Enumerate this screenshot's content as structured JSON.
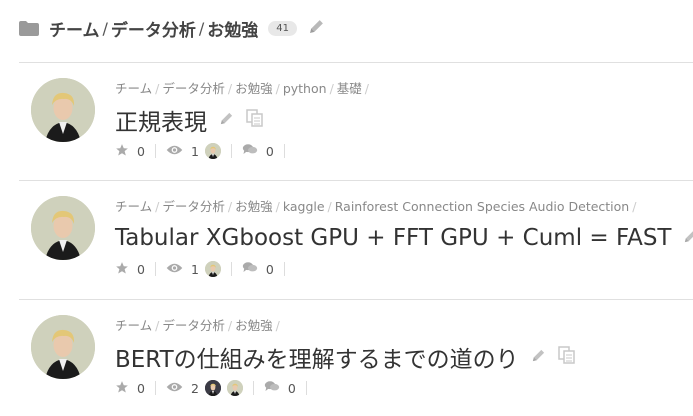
{
  "header": {
    "crumbs": [
      "チーム",
      "データ分析",
      "お勉強"
    ],
    "count": "41"
  },
  "posts": [
    {
      "categories": [
        "チーム",
        "データ分析",
        "お勉強",
        "python",
        "基礎"
      ],
      "title": "正規表現",
      "stars": "0",
      "views": "1",
      "comments": "0"
    },
    {
      "categories": [
        "チーム",
        "データ分析",
        "お勉強",
        "kaggle",
        "Rainforest Connection Species Audio Detection"
      ],
      "title": "Tabular XGboost GPU + FFT GPU + Cuml = FAST",
      "stars": "0",
      "views": "1",
      "comments": "0"
    },
    {
      "categories": [
        "チーム",
        "データ分析",
        "お勉強"
      ],
      "title": "BERTの仕組みを理解するまでの道のり",
      "stars": "0",
      "views": "2",
      "comments": "0"
    }
  ],
  "icons": {
    "folder": "folder-icon",
    "edit": "pencil-icon",
    "copy": "copy-icon",
    "star": "star-icon",
    "views": "eye-icon",
    "comments": "comments-icon"
  },
  "colors": {
    "text": "#333333",
    "muted": "#888888",
    "icon": "#b5b5b5",
    "badge": "#e8e8e8",
    "rule": "#e0e0e0"
  }
}
